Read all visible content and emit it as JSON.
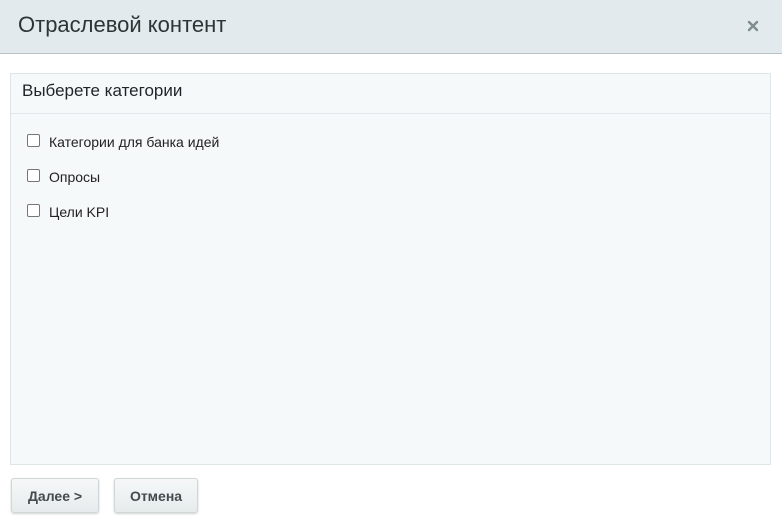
{
  "dialog": {
    "title": "Отраслевой контент",
    "close_icon": "close-icon"
  },
  "panel": {
    "title": "Выберете категории",
    "options": [
      {
        "label": "Категории для банка идей",
        "checked": false
      },
      {
        "label": "Опросы",
        "checked": false
      },
      {
        "label": "Цели KPI",
        "checked": false
      }
    ]
  },
  "footer": {
    "next_label": "Далее >",
    "cancel_label": "Отмена"
  }
}
